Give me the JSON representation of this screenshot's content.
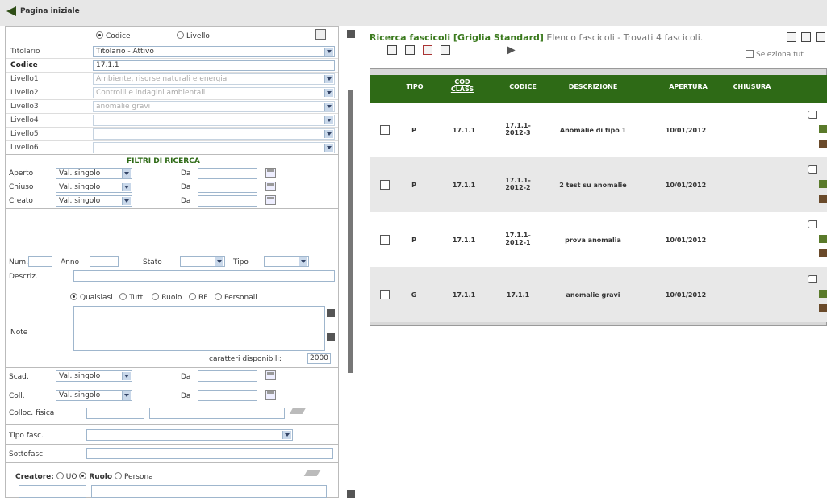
{
  "header": {
    "home": "Pagina iniziale"
  },
  "search": {
    "mode_codice": "Codice",
    "mode_livello": "Livello",
    "titolario_label": "Titolario",
    "titolario_value": "Titolario - Attivo",
    "codice_label": "Codice",
    "codice_value": "17.1.1",
    "levels": [
      {
        "label": "Livello1",
        "value": "Ambiente, risorse naturali e energia"
      },
      {
        "label": "Livello2",
        "value": "Controlli e indagini ambientali"
      },
      {
        "label": "Livello3",
        "value": "anomalie gravi"
      },
      {
        "label": "Livello4",
        "value": ""
      },
      {
        "label": "Livello5",
        "value": ""
      },
      {
        "label": "Livello6",
        "value": ""
      }
    ]
  },
  "filters": {
    "title": "FILTRI DI RICERCA",
    "date_rows": [
      {
        "label": "Aperto",
        "mode": "Val. singolo",
        "da": "Da"
      },
      {
        "label": "Chiuso",
        "mode": "Val. singolo",
        "da": "Da"
      },
      {
        "label": "Creato",
        "mode": "Val. singolo",
        "da": "Da"
      }
    ],
    "num": "Num.",
    "anno": "Anno",
    "stato": "Stato",
    "tipo": "Tipo",
    "descriz": "Descriz.",
    "note_opts": [
      "Qualsiasi",
      "Tutti",
      "Ruolo",
      "RF",
      "Personali"
    ],
    "note_label": "Note",
    "chars_label": "caratteri disponibili:",
    "chars_value": "2000",
    "scad": {
      "label": "Scad.",
      "mode": "Val. singolo",
      "da": "Da"
    },
    "coll": {
      "label": "Coll.",
      "mode": "Val. singolo",
      "da": "Da"
    },
    "colloc": "Colloc. fisica",
    "tipo_fasc": "Tipo fasc.",
    "sottofasc": "Sottofasc.",
    "creatore": "Creatore:",
    "creatore_opts": [
      "UO",
      "Ruolo",
      "Persona"
    ]
  },
  "results": {
    "title_green": "Ricerca fascicoli [Griglia Standard]",
    "title_gray": "Elenco fascicoli - Trovati 4 fascicoli.",
    "select_all": "Seleziona tut",
    "columns": [
      "TIPO",
      "COD CLASS",
      "CODICE",
      "DESCRIZIONE",
      "APERTURA",
      "CHIUSURA"
    ],
    "rows": [
      {
        "tipo": "P",
        "cod": "17.1.1",
        "codice": "17.1.1-2012-3",
        "desc": "Anomalie di tipo 1",
        "apertura": "10/01/2012"
      },
      {
        "tipo": "P",
        "cod": "17.1.1",
        "codice": "17.1.1-2012-2",
        "desc": "2 test su anomalie",
        "apertura": "10/01/2012"
      },
      {
        "tipo": "P",
        "cod": "17.1.1",
        "codice": "17.1.1-2012-1",
        "desc": "prova anomalia",
        "apertura": "10/01/2012"
      },
      {
        "tipo": "G",
        "cod": "17.1.1",
        "codice": "17.1.1",
        "desc": "anomalie gravi",
        "apertura": "10/01/2012"
      }
    ]
  }
}
